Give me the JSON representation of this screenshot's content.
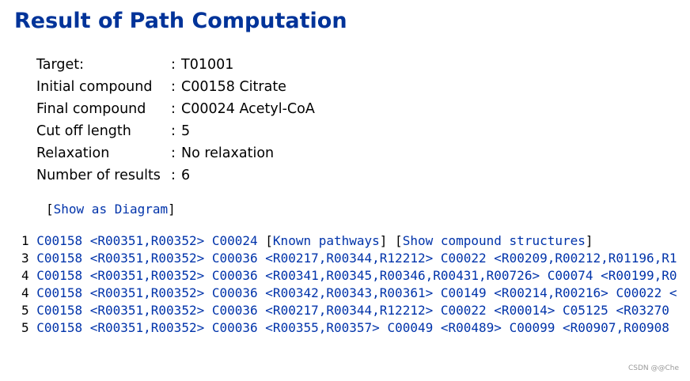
{
  "title": "Result of Path Computation",
  "params": [
    {
      "label": "Target:",
      "sep": ":",
      "value": "T01001"
    },
    {
      "label": "Initial compound",
      "sep": ":",
      "value": "C00158 Citrate"
    },
    {
      "label": "Final compound",
      "sep": ":",
      "value": "C00024 Acetyl-CoA"
    },
    {
      "label": "Cut off length",
      "sep": ":",
      "value": "5"
    },
    {
      "label": "Relaxation",
      "sep": ":",
      "value": "No relaxation"
    },
    {
      "label": "Number of results",
      "sep": ":",
      "value": "6"
    }
  ],
  "show_diagram": {
    "open": "[",
    "label": "Show as Diagram",
    "close": "]"
  },
  "extra_links": {
    "known_pathways": "Known pathways",
    "compound_structures": "Show compound structures"
  },
  "results": [
    {
      "length": "1",
      "tokens": [
        {
          "t": "C00158",
          "link": true
        },
        {
          "t": " ",
          "link": false
        },
        {
          "t": "<R00351,R00352>",
          "link": true
        },
        {
          "t": " ",
          "link": false
        },
        {
          "t": "C00024",
          "link": true
        }
      ],
      "has_extra": true
    },
    {
      "length": "3",
      "tokens": [
        {
          "t": "C00158",
          "link": true
        },
        {
          "t": " ",
          "link": false
        },
        {
          "t": "<R00351,R00352>",
          "link": true
        },
        {
          "t": " ",
          "link": false
        },
        {
          "t": "C00036",
          "link": true
        },
        {
          "t": " ",
          "link": false
        },
        {
          "t": "<R00217,R00344,R12212>",
          "link": true
        },
        {
          "t": " ",
          "link": false
        },
        {
          "t": "C00022",
          "link": true
        },
        {
          "t": " ",
          "link": false
        },
        {
          "t": "<R00209,R00212,R01196,R1",
          "link": true
        }
      ],
      "has_extra": false
    },
    {
      "length": "4",
      "tokens": [
        {
          "t": "C00158",
          "link": true
        },
        {
          "t": " ",
          "link": false
        },
        {
          "t": "<R00351,R00352>",
          "link": true
        },
        {
          "t": " ",
          "link": false
        },
        {
          "t": "C00036",
          "link": true
        },
        {
          "t": " ",
          "link": false
        },
        {
          "t": "<R00341,R00345,R00346,R00431,R00726>",
          "link": true
        },
        {
          "t": " ",
          "link": false
        },
        {
          "t": "C00074",
          "link": true
        },
        {
          "t": " ",
          "link": false
        },
        {
          "t": "<R00199,R0",
          "link": true
        }
      ],
      "has_extra": false
    },
    {
      "length": "4",
      "tokens": [
        {
          "t": "C00158",
          "link": true
        },
        {
          "t": " ",
          "link": false
        },
        {
          "t": "<R00351,R00352>",
          "link": true
        },
        {
          "t": " ",
          "link": false
        },
        {
          "t": "C00036",
          "link": true
        },
        {
          "t": " ",
          "link": false
        },
        {
          "t": "<R00342,R00343,R00361>",
          "link": true
        },
        {
          "t": " ",
          "link": false
        },
        {
          "t": "C00149",
          "link": true
        },
        {
          "t": " ",
          "link": false
        },
        {
          "t": "<R00214,R00216>",
          "link": true
        },
        {
          "t": " ",
          "link": false
        },
        {
          "t": "C00022",
          "link": true
        },
        {
          "t": " ",
          "link": false
        },
        {
          "t": "<",
          "link": true
        }
      ],
      "has_extra": false
    },
    {
      "length": "5",
      "tokens": [
        {
          "t": "C00158",
          "link": true
        },
        {
          "t": " ",
          "link": false
        },
        {
          "t": "<R00351,R00352>",
          "link": true
        },
        {
          "t": " ",
          "link": false
        },
        {
          "t": "C00036",
          "link": true
        },
        {
          "t": " ",
          "link": false
        },
        {
          "t": "<R00217,R00344,R12212>",
          "link": true
        },
        {
          "t": " ",
          "link": false
        },
        {
          "t": "C00022",
          "link": true
        },
        {
          "t": " ",
          "link": false
        },
        {
          "t": "<R00014>",
          "link": true
        },
        {
          "t": " ",
          "link": false
        },
        {
          "t": "C05125",
          "link": true
        },
        {
          "t": " ",
          "link": false
        },
        {
          "t": "<R03270",
          "link": true
        }
      ],
      "has_extra": false
    },
    {
      "length": "5",
      "tokens": [
        {
          "t": "C00158",
          "link": true
        },
        {
          "t": " ",
          "link": false
        },
        {
          "t": "<R00351,R00352>",
          "link": true
        },
        {
          "t": " ",
          "link": false
        },
        {
          "t": "C00036",
          "link": true
        },
        {
          "t": " ",
          "link": false
        },
        {
          "t": "<R00355,R00357>",
          "link": true
        },
        {
          "t": " ",
          "link": false
        },
        {
          "t": "C00049",
          "link": true
        },
        {
          "t": " ",
          "link": false
        },
        {
          "t": "<R00489>",
          "link": true
        },
        {
          "t": " ",
          "link": false
        },
        {
          "t": "C00099",
          "link": true
        },
        {
          "t": " ",
          "link": false
        },
        {
          "t": "<R00907,R00908",
          "link": true
        }
      ],
      "has_extra": false
    }
  ],
  "watermark": "CSDN @@Che",
  "colors": {
    "title": "#003399",
    "link": "#0033aa",
    "text": "#000000"
  }
}
